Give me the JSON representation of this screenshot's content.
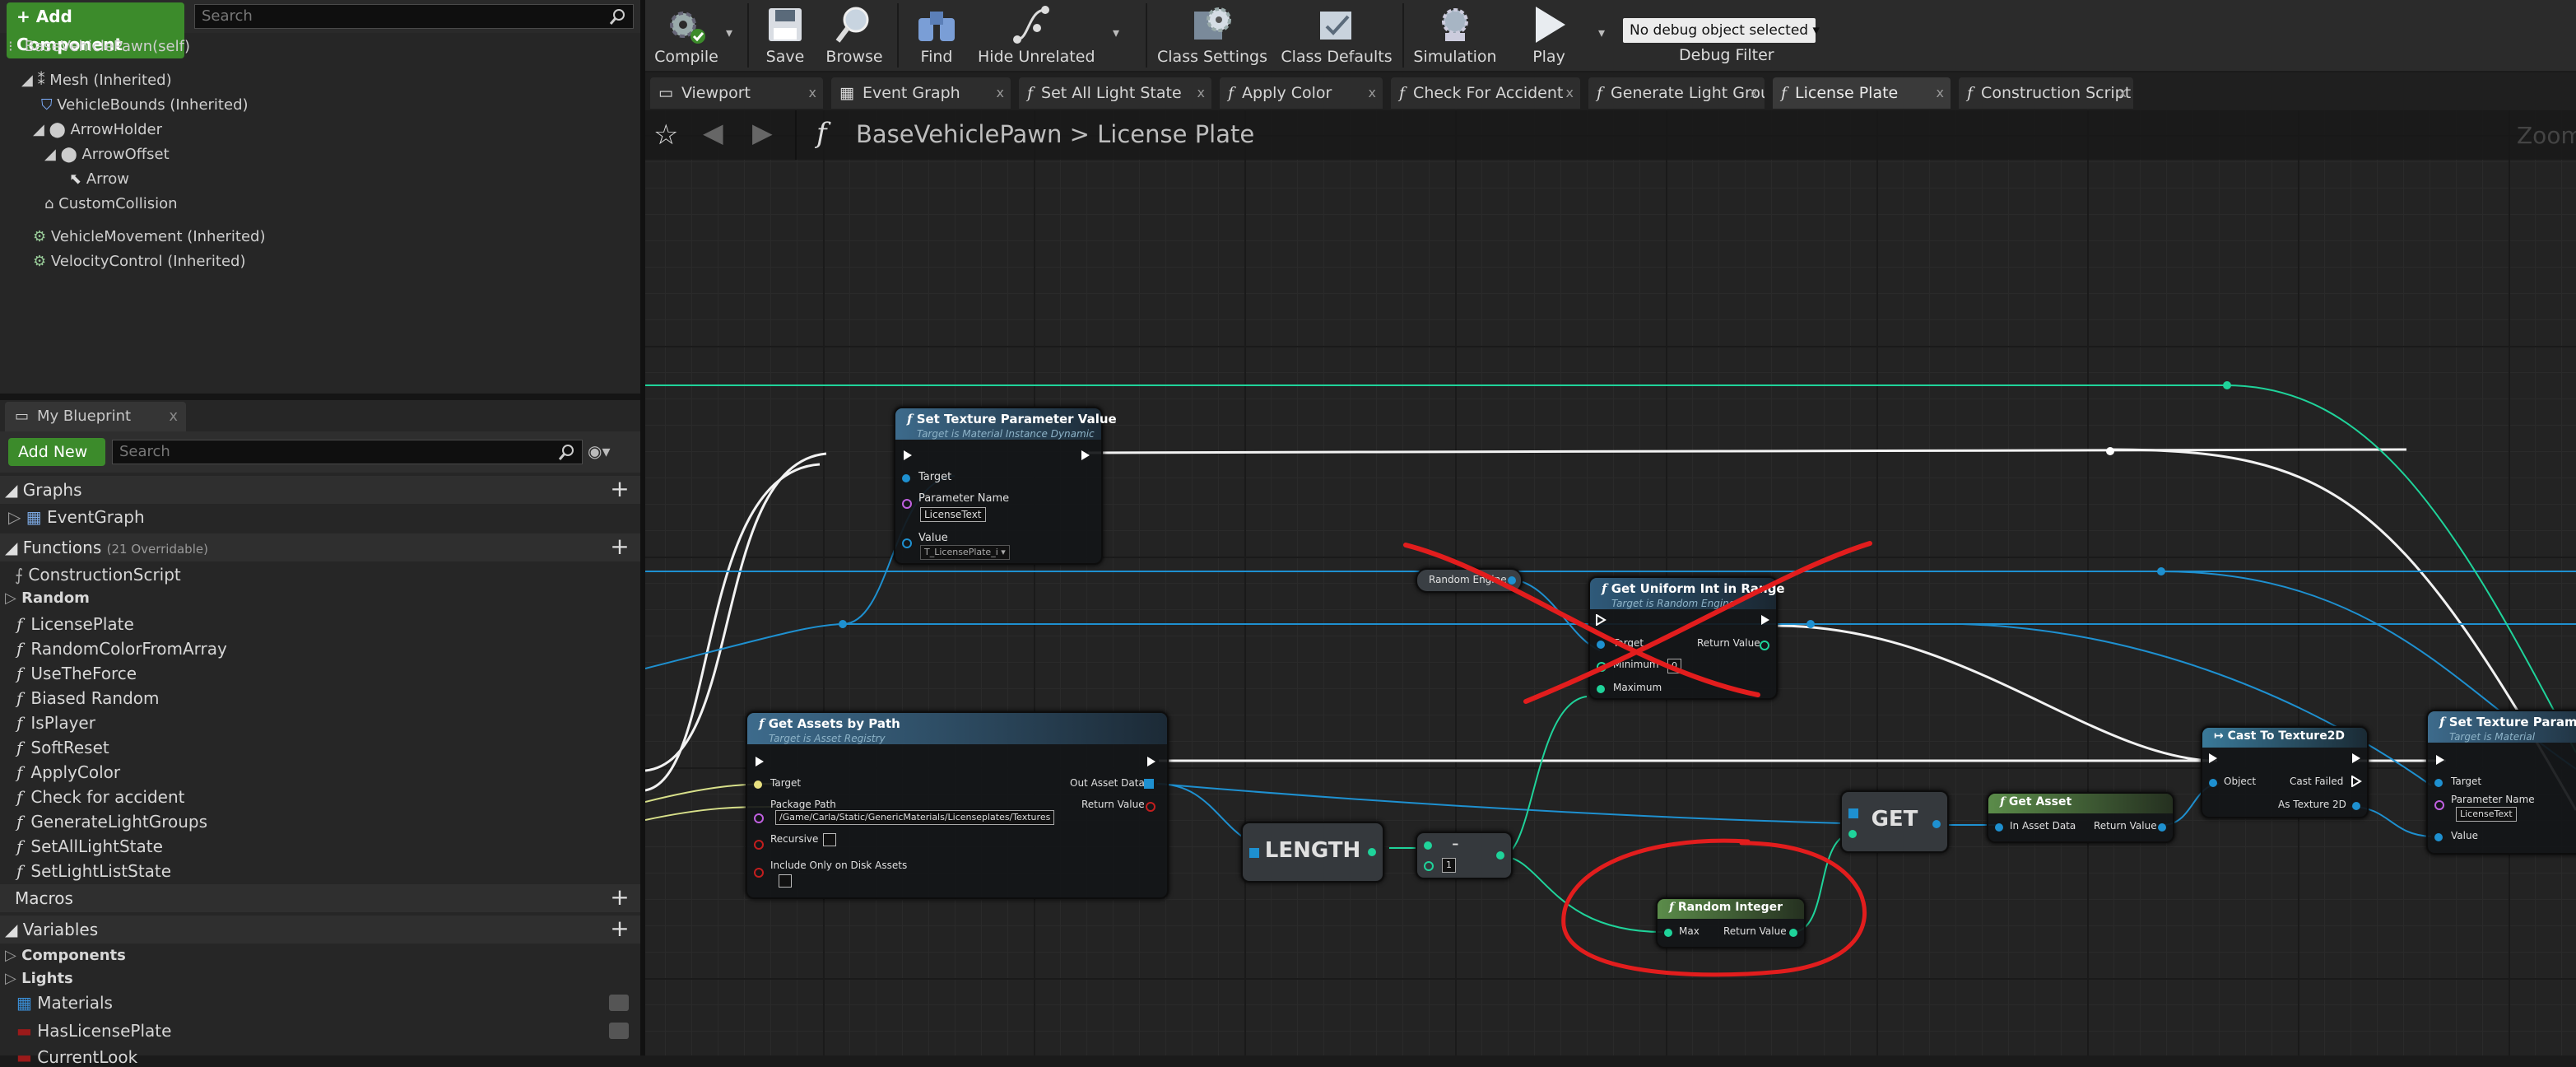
{
  "components_panel": {
    "add_component": "+ Add Component",
    "search_placeholder": "Search",
    "self_label": "BaseVehiclePawn(self)",
    "tree": [
      "Mesh (Inherited)",
      "VehicleBounds (Inherited)",
      "ArrowHolder",
      "ArrowOffset",
      "Arrow",
      "CustomCollision",
      "VehicleMovement (Inherited)",
      "VelocityControl (Inherited)"
    ]
  },
  "my_blueprint": {
    "tab_label": "My Blueprint",
    "add_new": "Add New",
    "search_placeholder": "Search",
    "graphs_header": "Graphs",
    "event_graph": "EventGraph",
    "functions_header": "Functions",
    "functions_count": "(21 Overridable)",
    "construction_script": "ConstructionScript",
    "random_category": "Random",
    "functions": [
      "LicensePlate",
      "RandomColorFromArray",
      "UseTheForce",
      "Biased Random",
      "IsPlayer",
      "SoftReset",
      "ApplyColor",
      "Check for accident",
      "GenerateLightGroups",
      "SetAllLightState",
      "SetLightListState"
    ],
    "macros_header": "Macros",
    "variables_header": "Variables",
    "var_categories": [
      "Components",
      "Lights"
    ],
    "variables": [
      "Materials",
      "HasLicensePlate",
      "CurrentLook"
    ]
  },
  "toolbar": {
    "compile": "Compile",
    "save": "Save",
    "browse": "Browse",
    "find": "Find",
    "hide_unrelated": "Hide Unrelated",
    "class_settings": "Class Settings",
    "class_defaults": "Class Defaults",
    "simulation": "Simulation",
    "play": "Play",
    "debug_object": "No debug object selected",
    "debug_filter": "Debug Filter"
  },
  "tabs": [
    "Viewport",
    "Event Graph",
    "Set All Light State",
    "Apply Color",
    "Check For Accident",
    "Generate Light Grou",
    "License Plate",
    "Construction Script"
  ],
  "breadcrumb": {
    "root": "BaseVehiclePawn",
    "separator": ">",
    "current": "License Plate",
    "zoom": "Zoom"
  },
  "nodes": {
    "set_texture_1": {
      "title": "Set Texture Parameter Value",
      "subtitle": "Target is Material Instance Dynamic",
      "target": "Target",
      "param_name": "Parameter Name",
      "param_value": "LicenseText",
      "value": "Value",
      "value_box": "T_LicensePlate_i"
    },
    "random_engine": {
      "title": "Random Engine"
    },
    "uniform_int": {
      "title": "Get Uniform Int in Range",
      "subtitle": "Target is Random Engine",
      "target": "Target",
      "minimum": "Minimum",
      "minimum_value": "0",
      "maximum": "Maximum",
      "return_value": "Return Value"
    },
    "get_assets": {
      "title": "Get Assets by Path",
      "subtitle": "Target is Asset Registry",
      "target": "Target",
      "package_path": "Package Path",
      "path_value": "/Game/Carla/Static/GenericMaterials/Licenseplates/Textures",
      "recursive": "Recursive",
      "disk_only": "Include Only on Disk Assets",
      "out_asset_data": "Out Asset Data",
      "return_value": "Return Value"
    },
    "length": {
      "title": "LENGTH"
    },
    "subtract": {
      "title": "-",
      "value": "1"
    },
    "random_integer": {
      "title": "Random Integer",
      "max": "Max",
      "return_value": "Return Value"
    },
    "get": {
      "title": "GET"
    },
    "get_asset": {
      "title": "Get Asset",
      "in_asset_data": "In Asset Data",
      "return_value": "Return Value"
    },
    "cast": {
      "title": "Cast To Texture2D",
      "object": "Object",
      "cast_failed": "Cast Failed",
      "as_texture": "As Texture 2D"
    },
    "set_texture_2": {
      "title": "Set Texture Parameter V",
      "subtitle": "Target is Material",
      "target": "Target",
      "param_name": "Parameter Name",
      "param_value": "LicenseText",
      "value": "Value"
    }
  },
  "colors": {
    "accent_green": "#3c8b2b",
    "exec_wire": "#ffffff",
    "object_wire": "#1e9cd8",
    "int_wire": "#1fe0a0",
    "annotation_red": "#e21d1d"
  }
}
